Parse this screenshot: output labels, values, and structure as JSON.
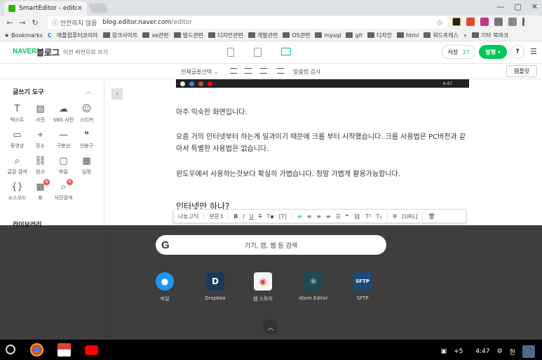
{
  "browser": {
    "tab_title": "SmartEditor - editor",
    "security_label": "안전하지 않음",
    "url_host": "blog.editor.naver.com",
    "url_path": "/editor"
  },
  "bookmarks": {
    "items": [
      "Bookmarks",
      "애플컴퓨터코리아",
      "링크사이트",
      "xe관련",
      "빌드관련",
      "디자인관련",
      "개발관련",
      "OS관련",
      "mysql",
      "git",
      "디자인",
      "html",
      "워드프레스"
    ],
    "other_label": "기타 북마크"
  },
  "header": {
    "logo": "NAVER",
    "service": "블로그",
    "prev_version": "이전 버전으로 쓰기",
    "save_label": "저장",
    "save_count": "37",
    "publish_label": "발행",
    "help_label": "?"
  },
  "format_bar": {
    "font_select": "전체글꼴선택",
    "spell_check": "맞춤법 검사",
    "template": "템플릿"
  },
  "sidebar": {
    "title": "글쓰기 도구",
    "library": "라이브러리",
    "tools": [
      {
        "label": "텍스트",
        "icon": "T"
      },
      {
        "label": "사진",
        "icon": "▨"
      },
      {
        "label": "SNS 사진",
        "icon": "☁"
      },
      {
        "label": "스티커",
        "icon": "☺"
      },
      {
        "label": "동영상",
        "icon": "▭"
      },
      {
        "label": "장소",
        "icon": "⌖"
      },
      {
        "label": "구분선",
        "icon": "—"
      },
      {
        "label": "인용구",
        "icon": "❝"
      },
      {
        "label": "글감 검색",
        "icon": "⌕"
      },
      {
        "label": "링크",
        "icon": "⛓"
      },
      {
        "label": "파일",
        "icon": "▢"
      },
      {
        "label": "일정",
        "icon": "▦"
      },
      {
        "label": "소스코드",
        "icon": "{}"
      },
      {
        "label": "표",
        "icon": "▦",
        "badge": "N"
      },
      {
        "label": "사진검색",
        "icon": "⌕",
        "badge": "N"
      }
    ]
  },
  "content": {
    "p1": "아주 익숙한 화면입니다.",
    "p2": "요즘 거의 인터넷부터 하는게 일과이기 때문에 크롬 부터 시작했습니다. 크롬 사용법은 PC버전과 같아서 특별한 사용법은 없습니다.",
    "p3": "윈도우에서 사용하는것보다 확실히 가볍습니다. 정말 가볍게 활용가능합니다.",
    "heading": "인터넷만 하나?",
    "toolbar_font": "나눔고딕",
    "toolbar_size": "본문3"
  },
  "launcher": {
    "search_placeholder": "기기, 앱, 웹 등 검색",
    "apps": [
      {
        "label": "파일",
        "color": "#2196f3",
        "glyph": "●"
      },
      {
        "label": "Dropbox",
        "color": "#1a3a5c",
        "glyph": "D"
      },
      {
        "label": "웹 스토어",
        "color": "#f5f5f5",
        "glyph": "◉"
      },
      {
        "label": "Atom Editor",
        "color": "#1e4a52",
        "glyph": "⚛"
      },
      {
        "label": "SFTP",
        "color": "#1a4b7a",
        "glyph": "SFTP"
      }
    ]
  },
  "shelf": {
    "notifications": "+5",
    "time": "4:47",
    "ime": "한"
  }
}
